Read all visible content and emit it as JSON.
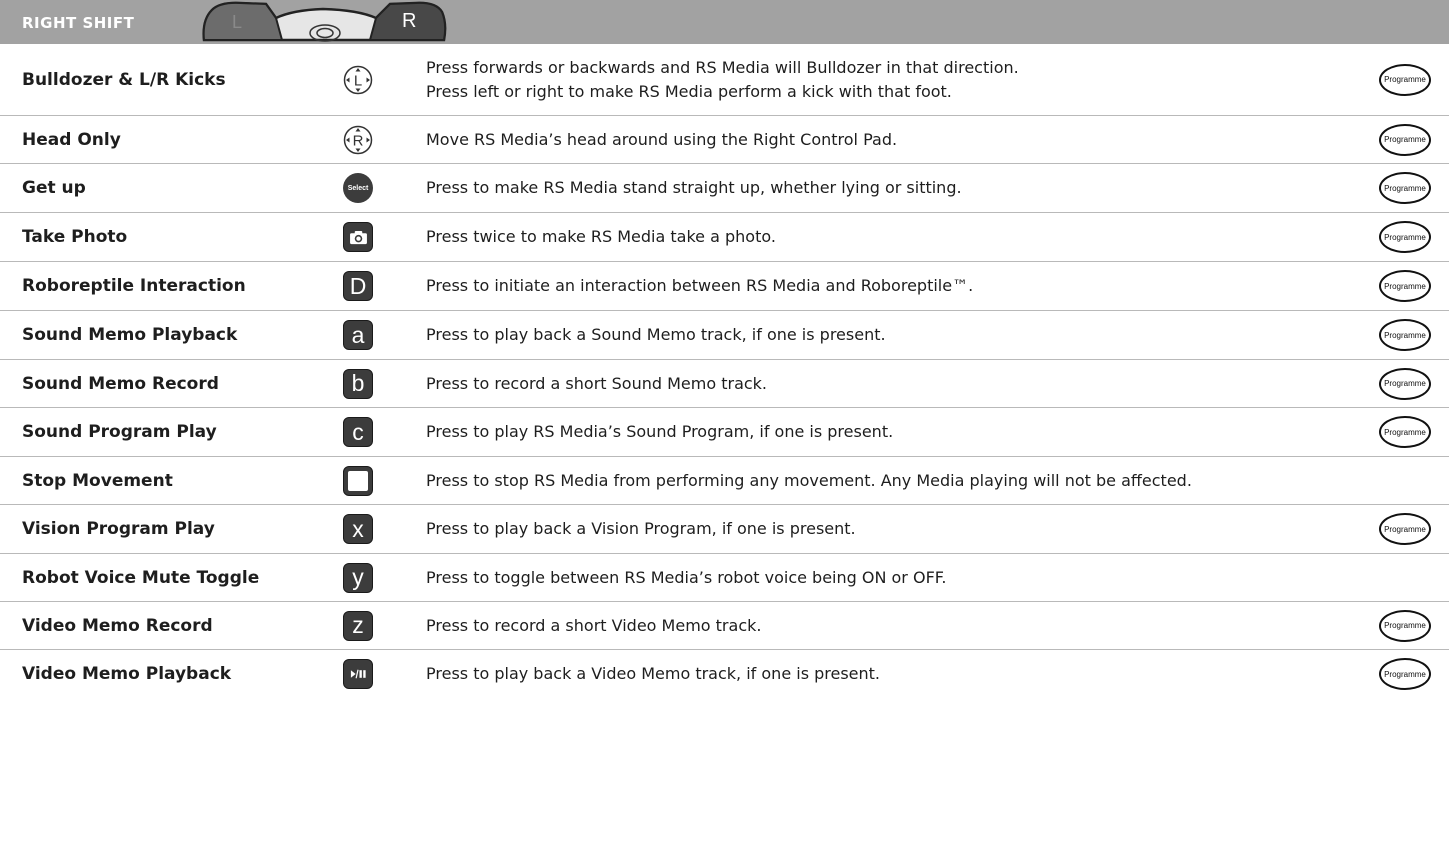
{
  "header": {
    "title": "RIGHT SHIFT",
    "controller_left": "L",
    "controller_right": "R"
  },
  "programme_label": "Programme",
  "rows": [
    {
      "label": "Bulldozer & L/R Kicks",
      "icon": "left-control-pad-icon",
      "icon_text": "L",
      "desc": [
        "Press forwards or backwards and RS Media will Bulldozer in that direction.",
        "Press left or right to make RS Media perform a kick with that foot."
      ],
      "programme": true
    },
    {
      "label": "Head Only",
      "icon": "right-control-pad-icon",
      "icon_text": "R",
      "desc": [
        "Move RS Media’s head around using the Right Control Pad."
      ],
      "programme": true
    },
    {
      "label": "Get up",
      "icon": "select-button-icon",
      "icon_text": "Select",
      "desc": [
        "Press to make RS Media stand straight up, whether lying or sitting."
      ],
      "programme": true
    },
    {
      "label": "Take Photo",
      "icon": "camera-button-icon",
      "icon_text": "",
      "desc": [
        "Press twice to make RS Media take a photo."
      ],
      "programme": true
    },
    {
      "label": "Roboreptile Interaction",
      "icon": "d-button-icon",
      "icon_text": "D",
      "desc": [
        "Press to initiate an interaction between RS Media and Roboreptile™."
      ],
      "programme": true
    },
    {
      "label": "Sound Memo Playback",
      "icon": "a-button-icon",
      "icon_text": "a",
      "desc": [
        "Press to play back a Sound Memo track, if one is present."
      ],
      "programme": true
    },
    {
      "label": "Sound Memo Record",
      "icon": "b-button-icon",
      "icon_text": "b",
      "desc": [
        "Press to record a short Sound Memo track."
      ],
      "programme": true
    },
    {
      "label": "Sound Program Play",
      "icon": "c-button-icon",
      "icon_text": "c",
      "desc": [
        "Press to play RS Media’s Sound Program, if one is present."
      ],
      "programme": true
    },
    {
      "label": "Stop Movement",
      "icon": "stop-button-icon",
      "icon_text": "",
      "desc": [
        "Press to stop RS Media from performing any movement. Any Media playing will not be affected."
      ],
      "programme": false
    },
    {
      "label": "Vision Program Play",
      "icon": "x-button-icon",
      "icon_text": "x",
      "desc": [
        "Press to play back a Vision Program, if one is present."
      ],
      "programme": true
    },
    {
      "label": "Robot Voice Mute Toggle",
      "icon": "y-button-icon",
      "icon_text": "y",
      "desc": [
        "Press to toggle between RS Media’s robot voice being ON or OFF."
      ],
      "programme": false
    },
    {
      "label": "Video Memo Record",
      "icon": "z-button-icon",
      "icon_text": "z",
      "desc": [
        "Press to record a short Video Memo track."
      ],
      "programme": true
    },
    {
      "label": "Video Memo Playback",
      "icon": "play-pause-button-icon",
      "icon_text": "",
      "desc": [
        "Press to play back a Video Memo track, if one is present."
      ],
      "programme": true
    }
  ]
}
